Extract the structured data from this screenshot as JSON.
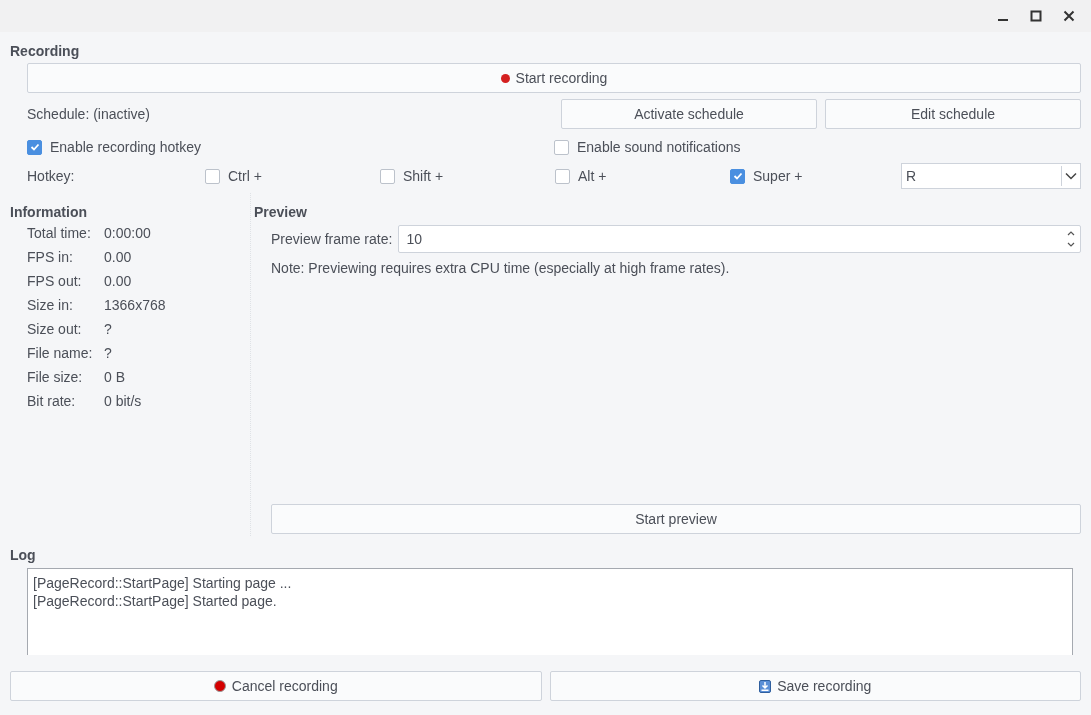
{
  "recording": {
    "title": "Recording",
    "start_button": "Start recording",
    "schedule_label": "Schedule: (inactive)",
    "schedule_buttons": [
      "Activate schedule",
      "Edit schedule"
    ],
    "options": [
      {
        "label": "Enable recording hotkey",
        "checked": true
      },
      {
        "label": "Enable sound notifications",
        "checked": false
      }
    ],
    "hotkey": {
      "label": "Hotkey:",
      "modifiers": [
        {
          "label": "Ctrl +",
          "checked": false
        },
        {
          "label": "Shift +",
          "checked": false
        },
        {
          "label": "Alt +",
          "checked": false
        },
        {
          "label": "Super +",
          "checked": true
        }
      ],
      "key": "R"
    }
  },
  "information": {
    "title": "Information",
    "rows": [
      {
        "label": "Total time:",
        "value": "0:00:00"
      },
      {
        "label": "FPS in:",
        "value": "0.00"
      },
      {
        "label": "FPS out:",
        "value": "0.00"
      },
      {
        "label": "Size in:",
        "value": "1366x768"
      },
      {
        "label": "Size out:",
        "value": "?"
      },
      {
        "label": "File name:",
        "value": "?"
      },
      {
        "label": "File size:",
        "value": "0 B"
      },
      {
        "label": "Bit rate:",
        "value": "0 bit/s"
      }
    ]
  },
  "preview": {
    "title": "Preview",
    "frame_rate_label": "Preview frame rate:",
    "frame_rate": "10",
    "note": "Note: Previewing requires extra CPU time (especially at high frame rates).",
    "start_button": "Start preview"
  },
  "log": {
    "title": "Log",
    "lines": [
      "[PageRecord::StartPage] Starting page ...",
      "[PageRecord::StartPage] Started page."
    ]
  },
  "buttons": [
    {
      "label": "Cancel recording",
      "kind": "record"
    },
    {
      "label": "Save recording",
      "kind": "save"
    }
  ]
}
